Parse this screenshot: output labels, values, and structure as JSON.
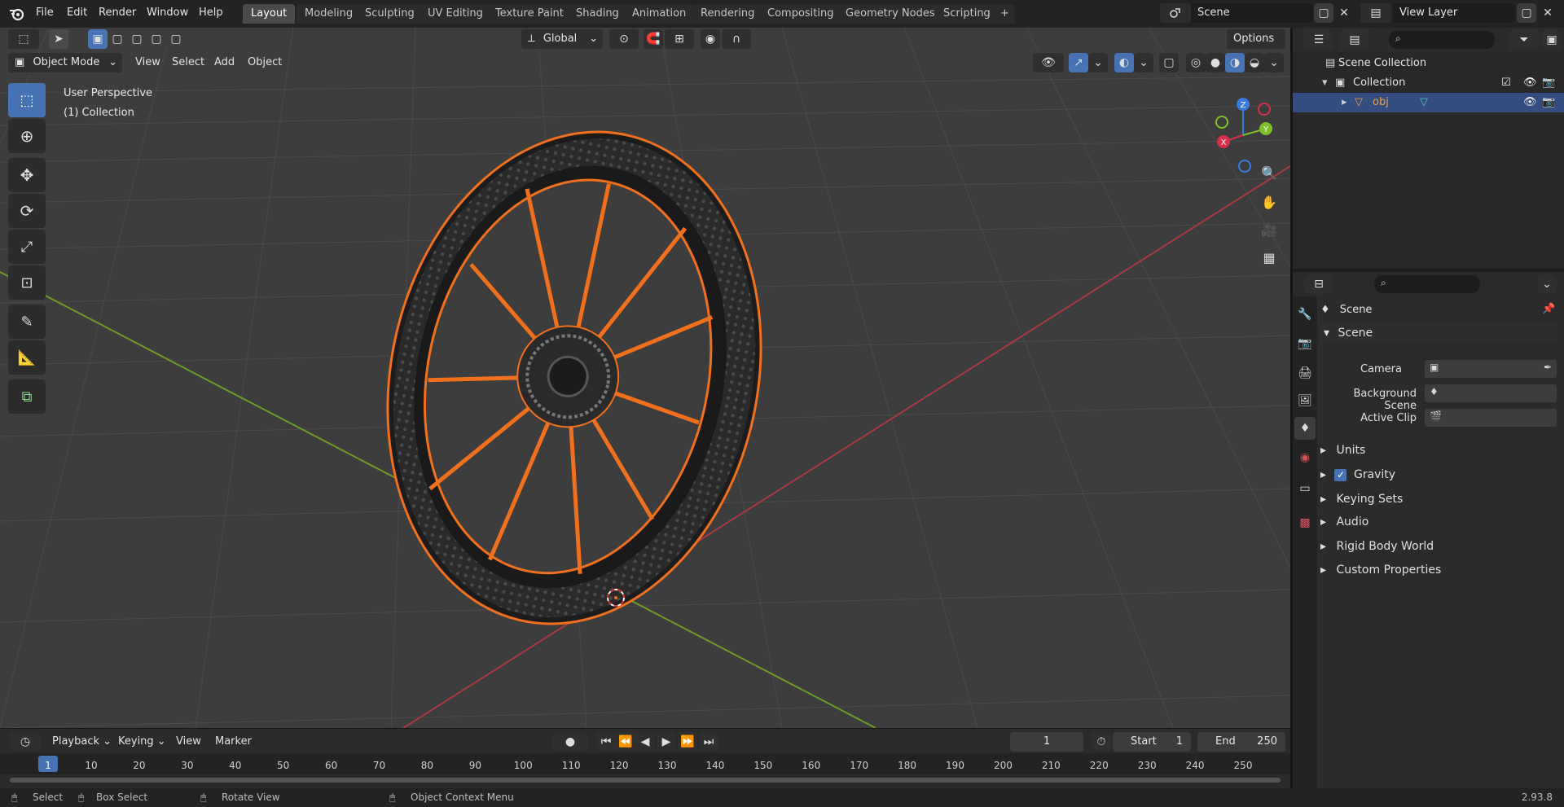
{
  "topbar": {
    "menus": [
      "File",
      "Edit",
      "Render",
      "Window",
      "Help"
    ],
    "workspaces": [
      "Layout",
      "Modeling",
      "Sculpting",
      "UV Editing",
      "Texture Paint",
      "Shading",
      "Animation",
      "Rendering",
      "Compositing",
      "Geometry Nodes",
      "Scripting"
    ],
    "active_workspace": "Layout",
    "add_tab": "+",
    "scene": "Scene",
    "view_layer": "View Layer"
  },
  "viewport_header": {
    "transform_orientation": "Global",
    "options": "Options",
    "mode": "Object Mode",
    "menus": [
      "View",
      "Select",
      "Add",
      "Object"
    ]
  },
  "viewport": {
    "perspective": "User Perspective",
    "collection": "(1) Collection",
    "gizmo": {
      "x": "X",
      "y": "Y",
      "z": "Z"
    },
    "object_color": "#f0701e",
    "x_axis_color": "#a83a45",
    "y_axis_color": "#6e9a27"
  },
  "outliner": {
    "scene_collection": "Scene Collection",
    "collection": "Collection",
    "object": "obj"
  },
  "properties": {
    "context": "Scene",
    "section": "Scene",
    "camera_label": "Camera",
    "background_label": "Background Scene",
    "clip_label": "Active Clip",
    "subpanels": [
      "Units",
      "Gravity",
      "Keying Sets",
      "Audio",
      "Rigid Body World",
      "Custom Properties"
    ]
  },
  "timeline": {
    "menus": [
      "Playback",
      "Keying",
      "View",
      "Marker"
    ],
    "current_frame": "1",
    "start_label": "Start",
    "start": "1",
    "end_label": "End",
    "end": "250",
    "ruler": [
      "1",
      "10",
      "20",
      "30",
      "40",
      "50",
      "60",
      "70",
      "80",
      "90",
      "100",
      "110",
      "120",
      "130",
      "140",
      "150",
      "160",
      "170",
      "180",
      "190",
      "200",
      "210",
      "220",
      "230",
      "240",
      "250"
    ]
  },
  "statusbar": {
    "select": "Select",
    "box_select": "Box Select",
    "rotate": "Rotate View",
    "context_menu": "Object Context Menu",
    "version": "2.93.8"
  }
}
